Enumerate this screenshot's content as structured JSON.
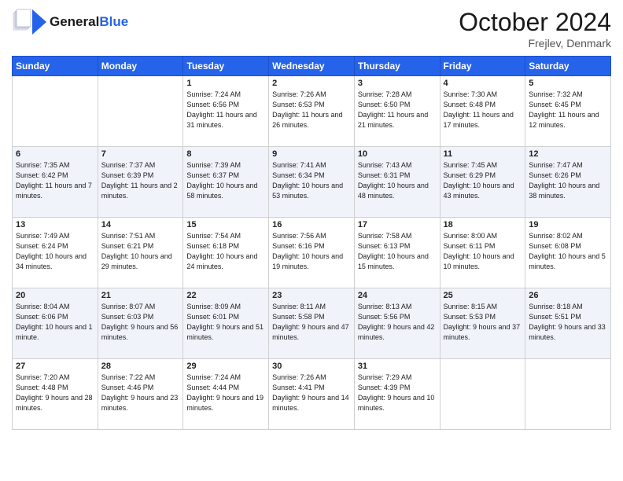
{
  "header": {
    "logo_general": "General",
    "logo_blue": "Blue",
    "month_title": "October 2024",
    "location": "Frejlev, Denmark"
  },
  "weekdays": [
    "Sunday",
    "Monday",
    "Tuesday",
    "Wednesday",
    "Thursday",
    "Friday",
    "Saturday"
  ],
  "weeks": [
    [
      {
        "day": "",
        "content": ""
      },
      {
        "day": "",
        "content": ""
      },
      {
        "day": "1",
        "content": "Sunrise: 7:24 AM\nSunset: 6:56 PM\nDaylight: 11 hours and 31 minutes."
      },
      {
        "day": "2",
        "content": "Sunrise: 7:26 AM\nSunset: 6:53 PM\nDaylight: 11 hours and 26 minutes."
      },
      {
        "day": "3",
        "content": "Sunrise: 7:28 AM\nSunset: 6:50 PM\nDaylight: 11 hours and 21 minutes."
      },
      {
        "day": "4",
        "content": "Sunrise: 7:30 AM\nSunset: 6:48 PM\nDaylight: 11 hours and 17 minutes."
      },
      {
        "day": "5",
        "content": "Sunrise: 7:32 AM\nSunset: 6:45 PM\nDaylight: 11 hours and 12 minutes."
      }
    ],
    [
      {
        "day": "6",
        "content": "Sunrise: 7:35 AM\nSunset: 6:42 PM\nDaylight: 11 hours and 7 minutes."
      },
      {
        "day": "7",
        "content": "Sunrise: 7:37 AM\nSunset: 6:39 PM\nDaylight: 11 hours and 2 minutes."
      },
      {
        "day": "8",
        "content": "Sunrise: 7:39 AM\nSunset: 6:37 PM\nDaylight: 10 hours and 58 minutes."
      },
      {
        "day": "9",
        "content": "Sunrise: 7:41 AM\nSunset: 6:34 PM\nDaylight: 10 hours and 53 minutes."
      },
      {
        "day": "10",
        "content": "Sunrise: 7:43 AM\nSunset: 6:31 PM\nDaylight: 10 hours and 48 minutes."
      },
      {
        "day": "11",
        "content": "Sunrise: 7:45 AM\nSunset: 6:29 PM\nDaylight: 10 hours and 43 minutes."
      },
      {
        "day": "12",
        "content": "Sunrise: 7:47 AM\nSunset: 6:26 PM\nDaylight: 10 hours and 38 minutes."
      }
    ],
    [
      {
        "day": "13",
        "content": "Sunrise: 7:49 AM\nSunset: 6:24 PM\nDaylight: 10 hours and 34 minutes."
      },
      {
        "day": "14",
        "content": "Sunrise: 7:51 AM\nSunset: 6:21 PM\nDaylight: 10 hours and 29 minutes."
      },
      {
        "day": "15",
        "content": "Sunrise: 7:54 AM\nSunset: 6:18 PM\nDaylight: 10 hours and 24 minutes."
      },
      {
        "day": "16",
        "content": "Sunrise: 7:56 AM\nSunset: 6:16 PM\nDaylight: 10 hours and 19 minutes."
      },
      {
        "day": "17",
        "content": "Sunrise: 7:58 AM\nSunset: 6:13 PM\nDaylight: 10 hours and 15 minutes."
      },
      {
        "day": "18",
        "content": "Sunrise: 8:00 AM\nSunset: 6:11 PM\nDaylight: 10 hours and 10 minutes."
      },
      {
        "day": "19",
        "content": "Sunrise: 8:02 AM\nSunset: 6:08 PM\nDaylight: 10 hours and 5 minutes."
      }
    ],
    [
      {
        "day": "20",
        "content": "Sunrise: 8:04 AM\nSunset: 6:06 PM\nDaylight: 10 hours and 1 minute."
      },
      {
        "day": "21",
        "content": "Sunrise: 8:07 AM\nSunset: 6:03 PM\nDaylight: 9 hours and 56 minutes."
      },
      {
        "day": "22",
        "content": "Sunrise: 8:09 AM\nSunset: 6:01 PM\nDaylight: 9 hours and 51 minutes."
      },
      {
        "day": "23",
        "content": "Sunrise: 8:11 AM\nSunset: 5:58 PM\nDaylight: 9 hours and 47 minutes."
      },
      {
        "day": "24",
        "content": "Sunrise: 8:13 AM\nSunset: 5:56 PM\nDaylight: 9 hours and 42 minutes."
      },
      {
        "day": "25",
        "content": "Sunrise: 8:15 AM\nSunset: 5:53 PM\nDaylight: 9 hours and 37 minutes."
      },
      {
        "day": "26",
        "content": "Sunrise: 8:18 AM\nSunset: 5:51 PM\nDaylight: 9 hours and 33 minutes."
      }
    ],
    [
      {
        "day": "27",
        "content": "Sunrise: 7:20 AM\nSunset: 4:48 PM\nDaylight: 9 hours and 28 minutes."
      },
      {
        "day": "28",
        "content": "Sunrise: 7:22 AM\nSunset: 4:46 PM\nDaylight: 9 hours and 23 minutes."
      },
      {
        "day": "29",
        "content": "Sunrise: 7:24 AM\nSunset: 4:44 PM\nDaylight: 9 hours and 19 minutes."
      },
      {
        "day": "30",
        "content": "Sunrise: 7:26 AM\nSunset: 4:41 PM\nDaylight: 9 hours and 14 minutes."
      },
      {
        "day": "31",
        "content": "Sunrise: 7:29 AM\nSunset: 4:39 PM\nDaylight: 9 hours and 10 minutes."
      },
      {
        "day": "",
        "content": ""
      },
      {
        "day": "",
        "content": ""
      }
    ]
  ]
}
